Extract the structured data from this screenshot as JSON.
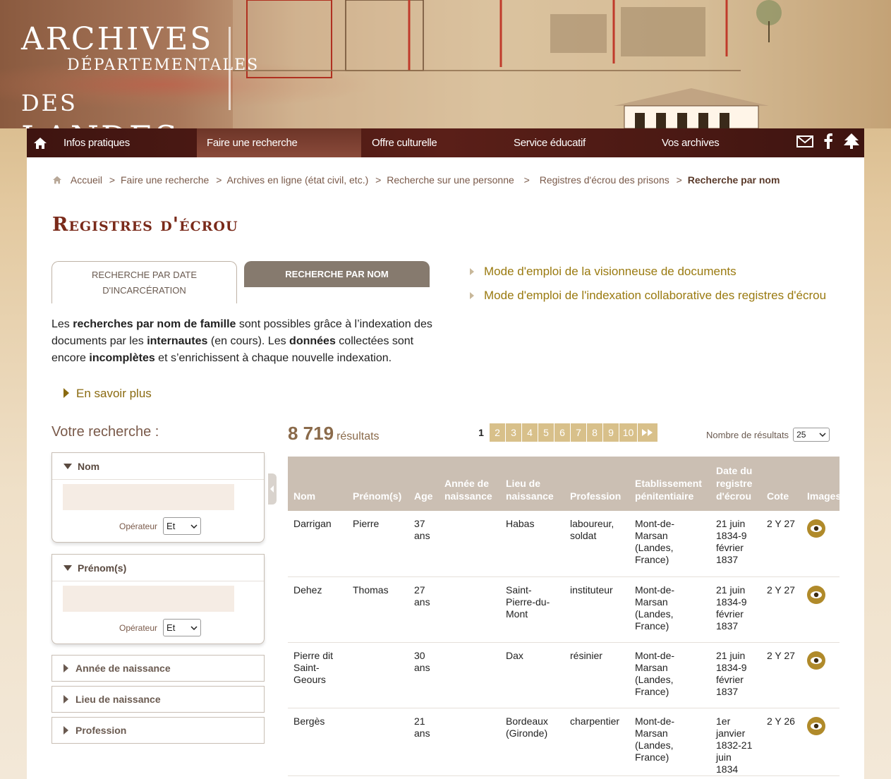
{
  "logo": {
    "line1": "ARCHIVES",
    "line2": "DÉPARTEMENTALES",
    "line3": "des LANDES"
  },
  "nav": {
    "items": [
      {
        "label": "Infos pratiques"
      },
      {
        "label": "Faire une recherche"
      },
      {
        "label": "Offre culturelle"
      },
      {
        "label": "Service éducatif"
      },
      {
        "label": "Vos archives"
      }
    ]
  },
  "breadcrumb": [
    "Accueil",
    "Faire une recherche",
    "Archives en ligne (état civil, etc.)",
    "Recherche sur une personne",
    "Registres d'écrou des prisons",
    "Recherche par nom"
  ],
  "page_title": "Registres d'écrou",
  "tabs": {
    "date_line1": "RECHERCHE PAR DATE",
    "date_line2": "D'INCARCÉRATION",
    "nom": "RECHERCHE PAR NOM"
  },
  "intro": {
    "t1": "Les ",
    "b1": "recherches par nom de famille",
    "t2": " sont possibles grâce à l’indexation des documents par les ",
    "b2": "internautes",
    "t3": " (en cours). Les ",
    "b3": "données",
    "t4": " collectées sont encore ",
    "b4": "incomplètes",
    "t5": " et s’enrichissent à chaque nouvelle indexation."
  },
  "savoir_plus": "En savoir plus",
  "mode_links": [
    "Mode d'emploi de la visionneuse de documents",
    "Mode d'emploi de l'indexation collaborative des registres d'écrou"
  ],
  "search": {
    "title": "Votre recherche :",
    "nom": {
      "label": "Nom",
      "value": "",
      "operator_label": "Opérateur",
      "operator": "Et"
    },
    "prenom": {
      "label": "Prénom(s)",
      "value": "",
      "operator_label": "Opérateur",
      "operator": "Et"
    },
    "collapsed": [
      "Année de naissance",
      "Lieu de naissance",
      "Profession"
    ]
  },
  "results": {
    "count": "8 719",
    "count_label": "résultats",
    "pages": [
      "1",
      "2",
      "3",
      "4",
      "5",
      "6",
      "7",
      "8",
      "9",
      "10"
    ],
    "current_page": "1",
    "per_page_label": "Nombre de résultats",
    "per_page": "25"
  },
  "table": {
    "headers": [
      "Nom",
      "Prénom(s)",
      "Age",
      "Année de naissance",
      "Lieu de naissance",
      "Profession",
      "Etablissement pénitentiaire",
      "Date du registre d'écrou",
      "Cote",
      "Images associées"
    ],
    "rows": [
      {
        "nom": "Darrigan",
        "prenom": "Pierre",
        "age": "37 ans",
        "annee": "",
        "lieu": "Habas",
        "profession": "laboureur, soldat",
        "etab": "Mont-de-Marsan (Landes, France)",
        "date": "21 juin 1834-9 février 1837",
        "cote": "2 Y 27"
      },
      {
        "nom": "Dehez",
        "prenom": "Thomas",
        "age": "27 ans",
        "annee": "",
        "lieu": "Saint-Pierre-du-Mont",
        "profession": "instituteur",
        "etab": "Mont-de-Marsan (Landes, France)",
        "date": "21 juin 1834-9 février 1837",
        "cote": "2 Y 27"
      },
      {
        "nom": "Pierre dit Saint-Geours",
        "prenom": "",
        "age": "30 ans",
        "annee": "",
        "lieu": "Dax",
        "profession": "résinier",
        "etab": "Mont-de-Marsan (Landes, France)",
        "date": "21 juin 1834-9 février 1837",
        "cote": "2 Y 27"
      },
      {
        "nom": "Bergès",
        "prenom": "",
        "age": "21 ans",
        "annee": "",
        "lieu": "Bordeaux (Gironde)",
        "profession": "charpentier",
        "etab": "Mont-de-Marsan (Landes, France)",
        "date": "1er janvier 1832-21 juin 1834",
        "cote": "2 Y 26"
      }
    ]
  },
  "colors": {
    "nav_bg": "#4a1a14",
    "accent_gold": "#9a7a10",
    "table_header": "#cbbfb3",
    "title": "#7a2a1a"
  }
}
